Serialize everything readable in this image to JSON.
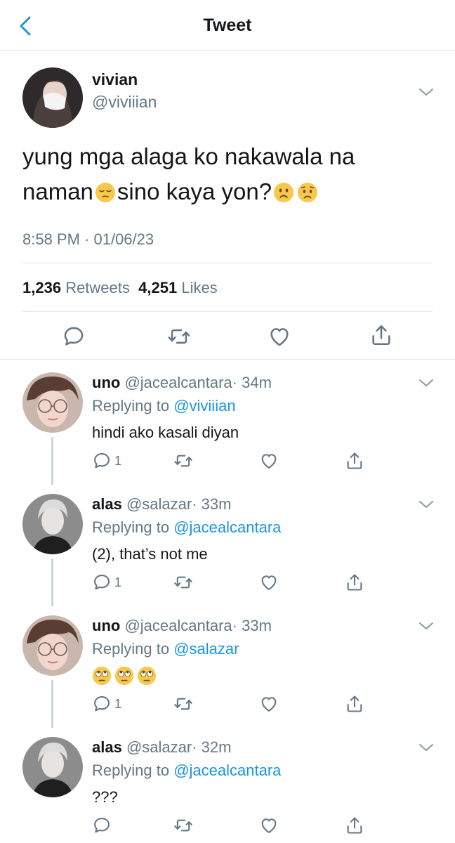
{
  "nav": {
    "title": "Tweet"
  },
  "tweet": {
    "name": "vivian",
    "handle": "@viviiian",
    "text_line1": "yung mga alaga ko nakawala na",
    "text_line2_a": "naman",
    "text_line2_b": "sino kaya yon?",
    "time": "8:58 PM · 01/06/23",
    "retweets_count": "1,236",
    "retweets_label": "Retweets",
    "likes_count": "4,251",
    "likes_label": "Likes"
  },
  "replies": [
    {
      "name": "uno",
      "handle": "@jacealcantara",
      "time": "· 34m",
      "replying_label": "Replying to",
      "replying_to": "@viviiian",
      "text": "hindi ako kasali diyan",
      "reply_count": "1"
    },
    {
      "name": "alas",
      "handle": "@salazar",
      "time": "· 33m",
      "replying_label": "Replying to",
      "replying_to": "@jacealcantara",
      "text": "(2), that’s not me",
      "reply_count": "1"
    },
    {
      "name": "uno",
      "handle": "@jacealcantara",
      "time": "· 33m",
      "replying_label": "Replying to",
      "replying_to": "@salazar",
      "text": "",
      "reply_count": "1"
    },
    {
      "name": "alas",
      "handle": "@salazar",
      "time": "· 32m",
      "replying_label": "Replying to",
      "replying_to": "@jacealcantara",
      "text": "???",
      "reply_count": ""
    }
  ],
  "icons": {
    "back": "back-arrow-icon",
    "caret": "chevron-down-icon",
    "reply": "reply-icon",
    "retweet": "retweet-icon",
    "like": "heart-icon",
    "share": "share-icon"
  },
  "colors": {
    "accent": "#1b95e0",
    "muted": "#657786",
    "text": "#14171a",
    "divider": "#e1e8ed"
  }
}
